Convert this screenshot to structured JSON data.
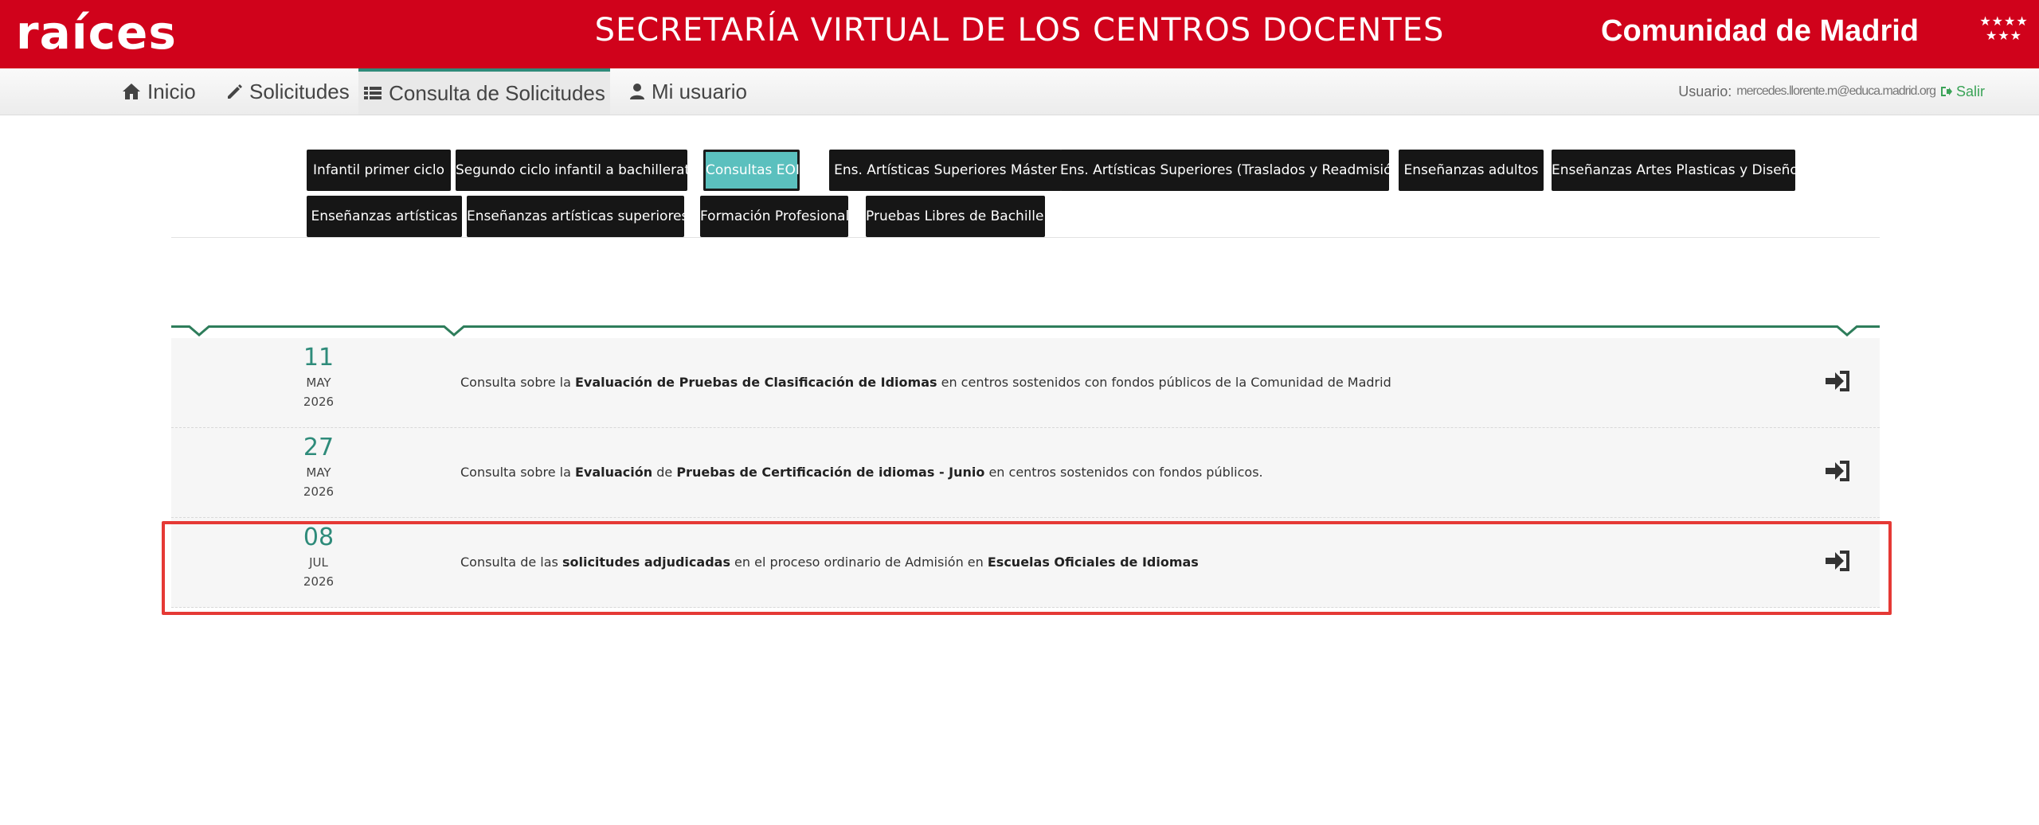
{
  "header": {
    "logo": "raíces",
    "title": "SECRETARÍA VIRTUAL DE LOS CENTROS DOCENTES",
    "brand": "Comunidad de Madrid",
    "brand_stars": "★★★★ ★★★"
  },
  "nav": {
    "items": [
      {
        "label": "Inicio",
        "icon": "home-icon"
      },
      {
        "label": "Solicitudes",
        "icon": "pencil-icon"
      },
      {
        "label": "Consulta de Solicitudes",
        "icon": "list-icon",
        "active": true
      },
      {
        "label": "Mi usuario",
        "icon": "user-icon"
      }
    ],
    "user_label": "Usuario:",
    "user_value": "mercedes.llorente.m@educa.madrid.org",
    "logout_label": "Salir"
  },
  "tabs": [
    {
      "label": "Infantil primer ciclo"
    },
    {
      "label": "Segundo ciclo infantil a bachillerato"
    },
    {
      "label": "Consultas EOI",
      "active": true
    },
    {
      "label": "Ens. Artísticas Superiores Máster"
    },
    {
      "label": "Ens. Artísticas Superiores (Traslados y Readmisión)"
    },
    {
      "label": "Enseñanzas adultos"
    },
    {
      "label": "Enseñanzas Artes Plasticas y Diseño"
    },
    {
      "label": "Enseñanzas artísticas"
    },
    {
      "label": "Enseñanzas artísticas superiores"
    },
    {
      "label": "Formación Profesional"
    },
    {
      "label": "Pruebas Libres de Bachiller"
    }
  ],
  "queries": [
    {
      "day": "11",
      "month": "MAY",
      "year": "2026",
      "parts": [
        {
          "text": "Consulta sobre la ",
          "bold": false
        },
        {
          "text": "Evaluación de Pruebas de Clasificación de Idiomas",
          "bold": true
        },
        {
          "text": " en centros sostenidos con fondos públicos de la Comunidad de Madrid",
          "bold": false
        }
      ]
    },
    {
      "day": "27",
      "month": "MAY",
      "year": "2026",
      "parts": [
        {
          "text": "Consulta sobre la ",
          "bold": false
        },
        {
          "text": "Evaluación",
          "bold": true
        },
        {
          "text": " de ",
          "bold": false
        },
        {
          "text": "Pruebas de Certificación de idiomas - Junio",
          "bold": true
        },
        {
          "text": " en centros sostenidos con fondos públicos.",
          "bold": false
        }
      ]
    },
    {
      "day": "08",
      "month": "JUL",
      "year": "2026",
      "highlighted": true,
      "parts": [
        {
          "text": "Consulta de las ",
          "bold": false
        },
        {
          "text": "solicitudes adjudicadas",
          "bold": true
        },
        {
          "text": " en el proceso ordinario de Admisión en ",
          "bold": false
        },
        {
          "text": "Escuelas Oficiales de Idiomas",
          "bold": true
        }
      ]
    }
  ],
  "colors": {
    "header_red": "#d0021b",
    "accent_teal": "#2e8b7a",
    "active_tab": "#5bc0be",
    "highlight_red": "#e53935",
    "logout_green": "#3aa357"
  }
}
